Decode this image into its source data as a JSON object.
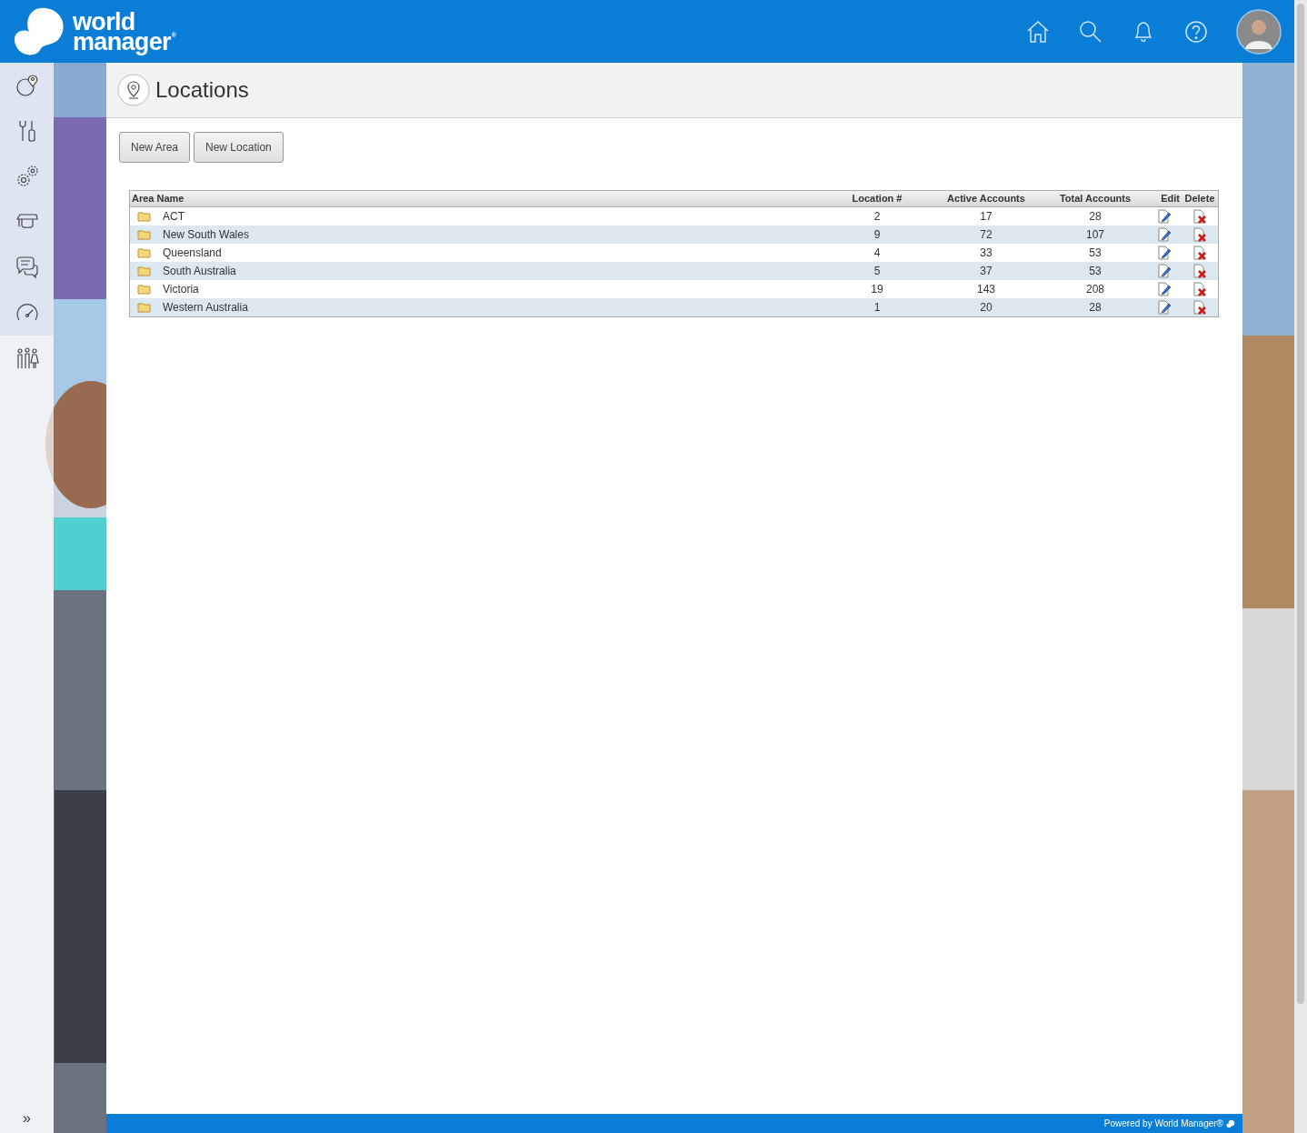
{
  "header": {
    "logo": {
      "line_1": "world",
      "line_2": "manager",
      "mark": "®"
    }
  },
  "page": {
    "title": "Locations"
  },
  "buttons": [
    "New Area",
    "New Location"
  ],
  "table": {
    "columns": [
      "Area Name",
      "Location #",
      "Active Accounts",
      "Total Accounts",
      "Edit",
      "Delete"
    ],
    "rows": [
      {
        "area": "ACT",
        "locations": "2",
        "active": "17",
        "total": "28"
      },
      {
        "area": "New South Wales",
        "locations": "9",
        "active": "72",
        "total": "107"
      },
      {
        "area": "Queensland",
        "locations": "4",
        "active": "33",
        "total": "53"
      },
      {
        "area": "South Australia",
        "locations": "5",
        "active": "37",
        "total": "53"
      },
      {
        "area": "Victoria",
        "locations": "19",
        "active": "143",
        "total": "208"
      },
      {
        "area": "Western Australia",
        "locations": "1",
        "active": "20",
        "total": "28"
      }
    ]
  },
  "sidebar": {
    "expand_toggle": "»"
  },
  "footer": {
    "text": "Powered by World Manager®"
  }
}
